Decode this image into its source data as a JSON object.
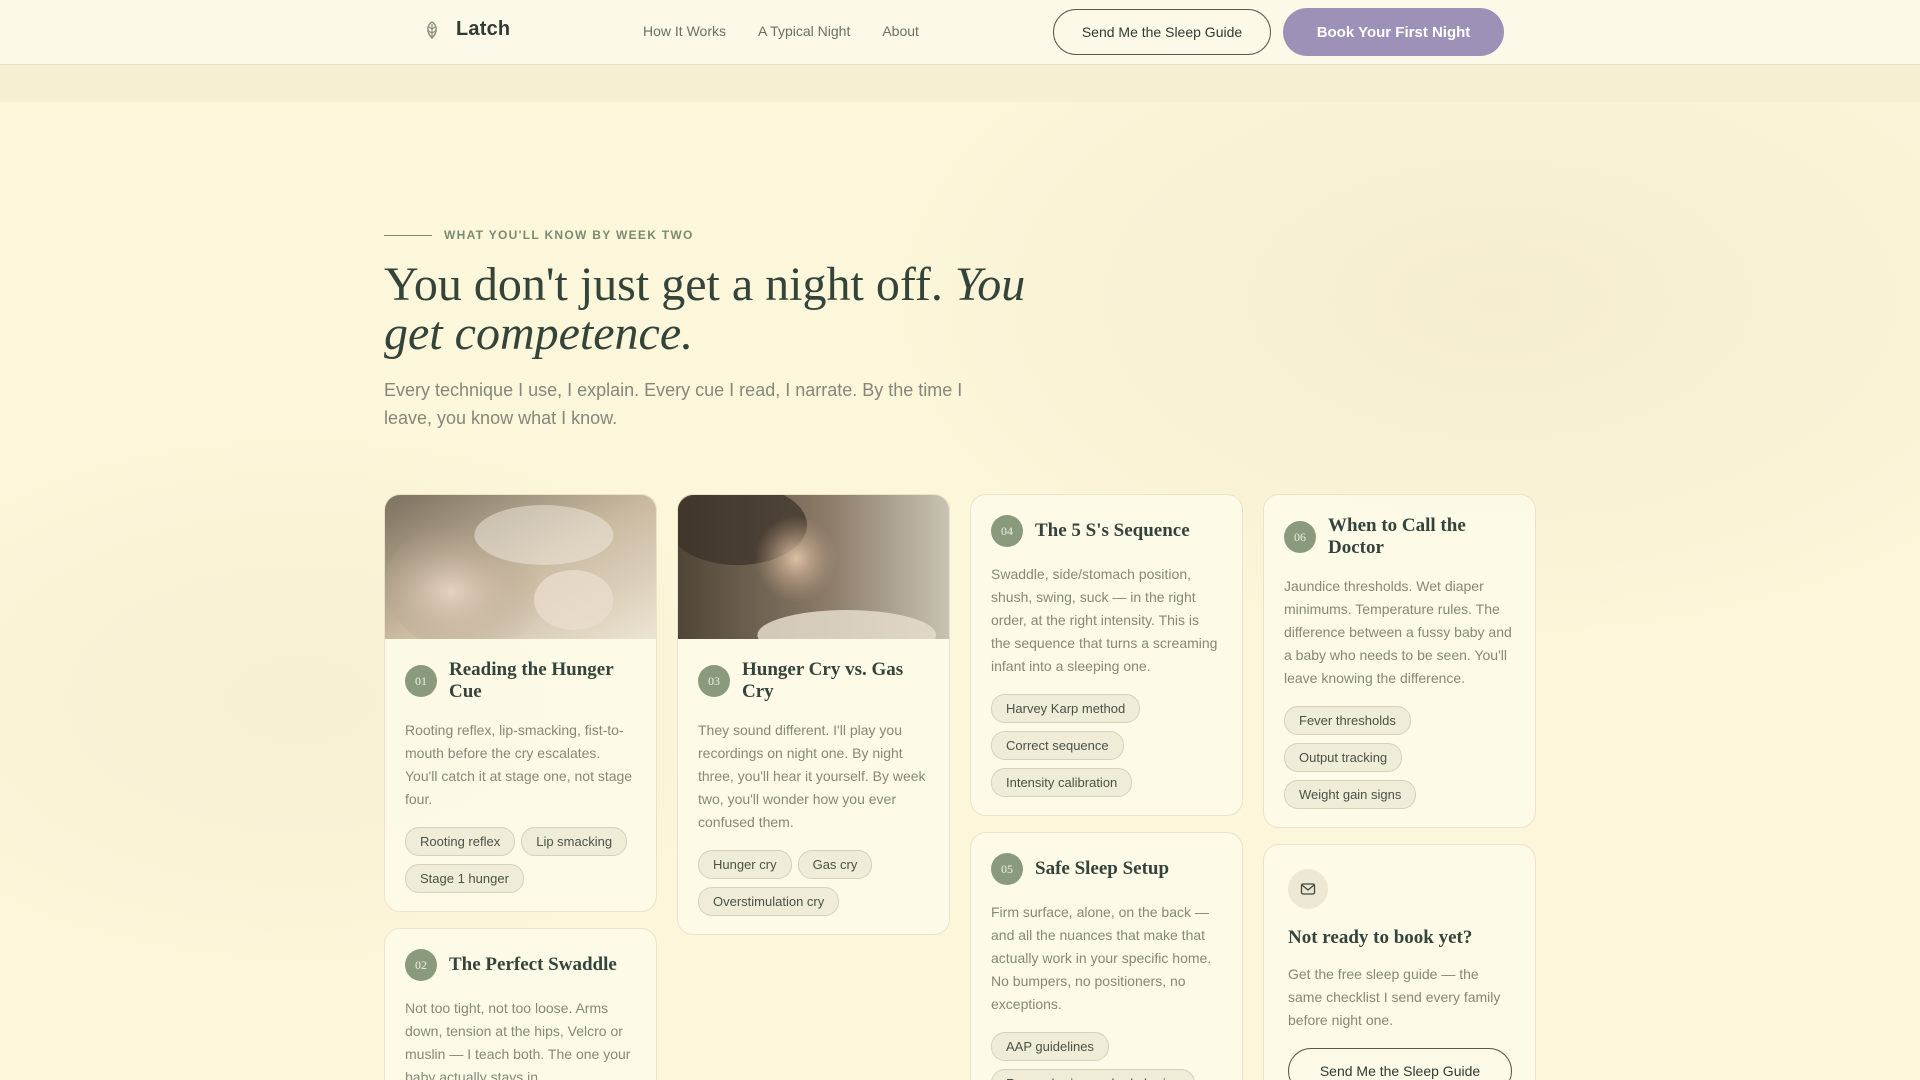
{
  "nav": {
    "brand": "Latch",
    "links": [
      "How It Works",
      "A Typical Night",
      "About"
    ],
    "secondary_cta": "Send Me the Sleep Guide",
    "primary_cta": "Book Your First Night"
  },
  "hero": {
    "eyebrow": "WHAT YOU'LL KNOW BY WEEK TWO",
    "headline_plain": "You don't just get a night off. ",
    "headline_italic": "You get competence.",
    "subhead": "Every technique I use, I explain. Every cue I read, I narrate. By the time I leave, you know what I know."
  },
  "cards": [
    {
      "num": "01",
      "title": "Reading the Hunger Cue",
      "desc": "Rooting reflex, lip-smacking, fist-to-mouth before the cry escalates. You'll catch it at stage one, not stage four.",
      "tags": [
        "Rooting reflex",
        "Lip smacking",
        "Stage 1 hunger"
      ]
    },
    {
      "num": "02",
      "title": "The Perfect Swaddle",
      "desc": "Not too tight, not too loose. Arms down, tension at the hips, Velcro or muslin — I teach both. The one your baby actually stays in.",
      "tags": []
    },
    {
      "num": "03",
      "title": "Hunger Cry vs. Gas Cry",
      "desc": "They sound different. I'll play you recordings on night one. By night three, you'll hear it yourself. By week two, you'll wonder how you ever confused them.",
      "tags": [
        "Hunger cry",
        "Gas cry",
        "Overstimulation cry"
      ]
    },
    {
      "num": "04",
      "title": "The 5 S's Sequence",
      "desc": "Swaddle, side/stomach position, shush, swing, suck — in the right order, at the right intensity. This is the sequence that turns a screaming infant into a sleeping one.",
      "tags": [
        "Harvey Karp method",
        "Correct sequence",
        "Intensity calibration"
      ]
    },
    {
      "num": "05",
      "title": "Safe Sleep Setup",
      "desc": "Firm surface, alone, on the back — and all the nuances that make that actually work in your specific home. No bumpers, no positioners, no exceptions.",
      "tags": [
        "AAP guidelines",
        "Room-sharing vs. bed-sharing"
      ]
    },
    {
      "num": "06",
      "title": "When to Call the Doctor",
      "desc": "Jaundice thresholds. Wet diaper minimums. Temperature rules. The difference between a fussy baby and a baby who needs to be seen. You'll leave knowing the difference.",
      "tags": [
        "Fever thresholds",
        "Output tracking",
        "Weight gain signs"
      ]
    }
  ],
  "cta_card": {
    "icon": "mail-icon",
    "title": "Not ready to book yet?",
    "desc": "Get the free sleep guide — the same checklist I send every family before night one.",
    "button": "Send Me the Sleep Guide"
  },
  "colors": {
    "background": "#fcf6da",
    "accent_purple": "#9e91b8",
    "badge_green": "#8a9a7c",
    "heading": "#34443a"
  }
}
